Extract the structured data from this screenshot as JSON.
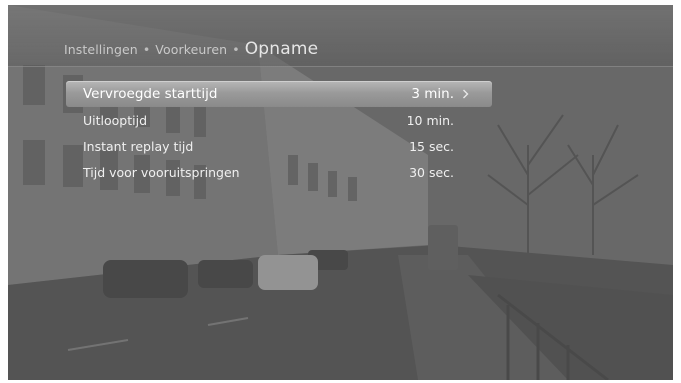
{
  "breadcrumb": {
    "items": [
      "Instellingen",
      "Voorkeuren"
    ],
    "separator": "•",
    "current": "Opname"
  },
  "menu": {
    "items": [
      {
        "label": "Vervroegde starttijd",
        "value": "3 min.",
        "selected": true
      },
      {
        "label": "Uitlooptijd",
        "value": "10 min.",
        "selected": false
      },
      {
        "label": "Instant replay tijd",
        "value": "15 sec.",
        "selected": false
      },
      {
        "label": "Tijd voor vooruitspringen",
        "value": "30 sec.",
        "selected": false
      }
    ]
  },
  "icons": {
    "selected_indicator": "chevron-right-icon"
  },
  "colors": {
    "highlight": "#a6a6a6",
    "text": "#f0f0f0"
  }
}
